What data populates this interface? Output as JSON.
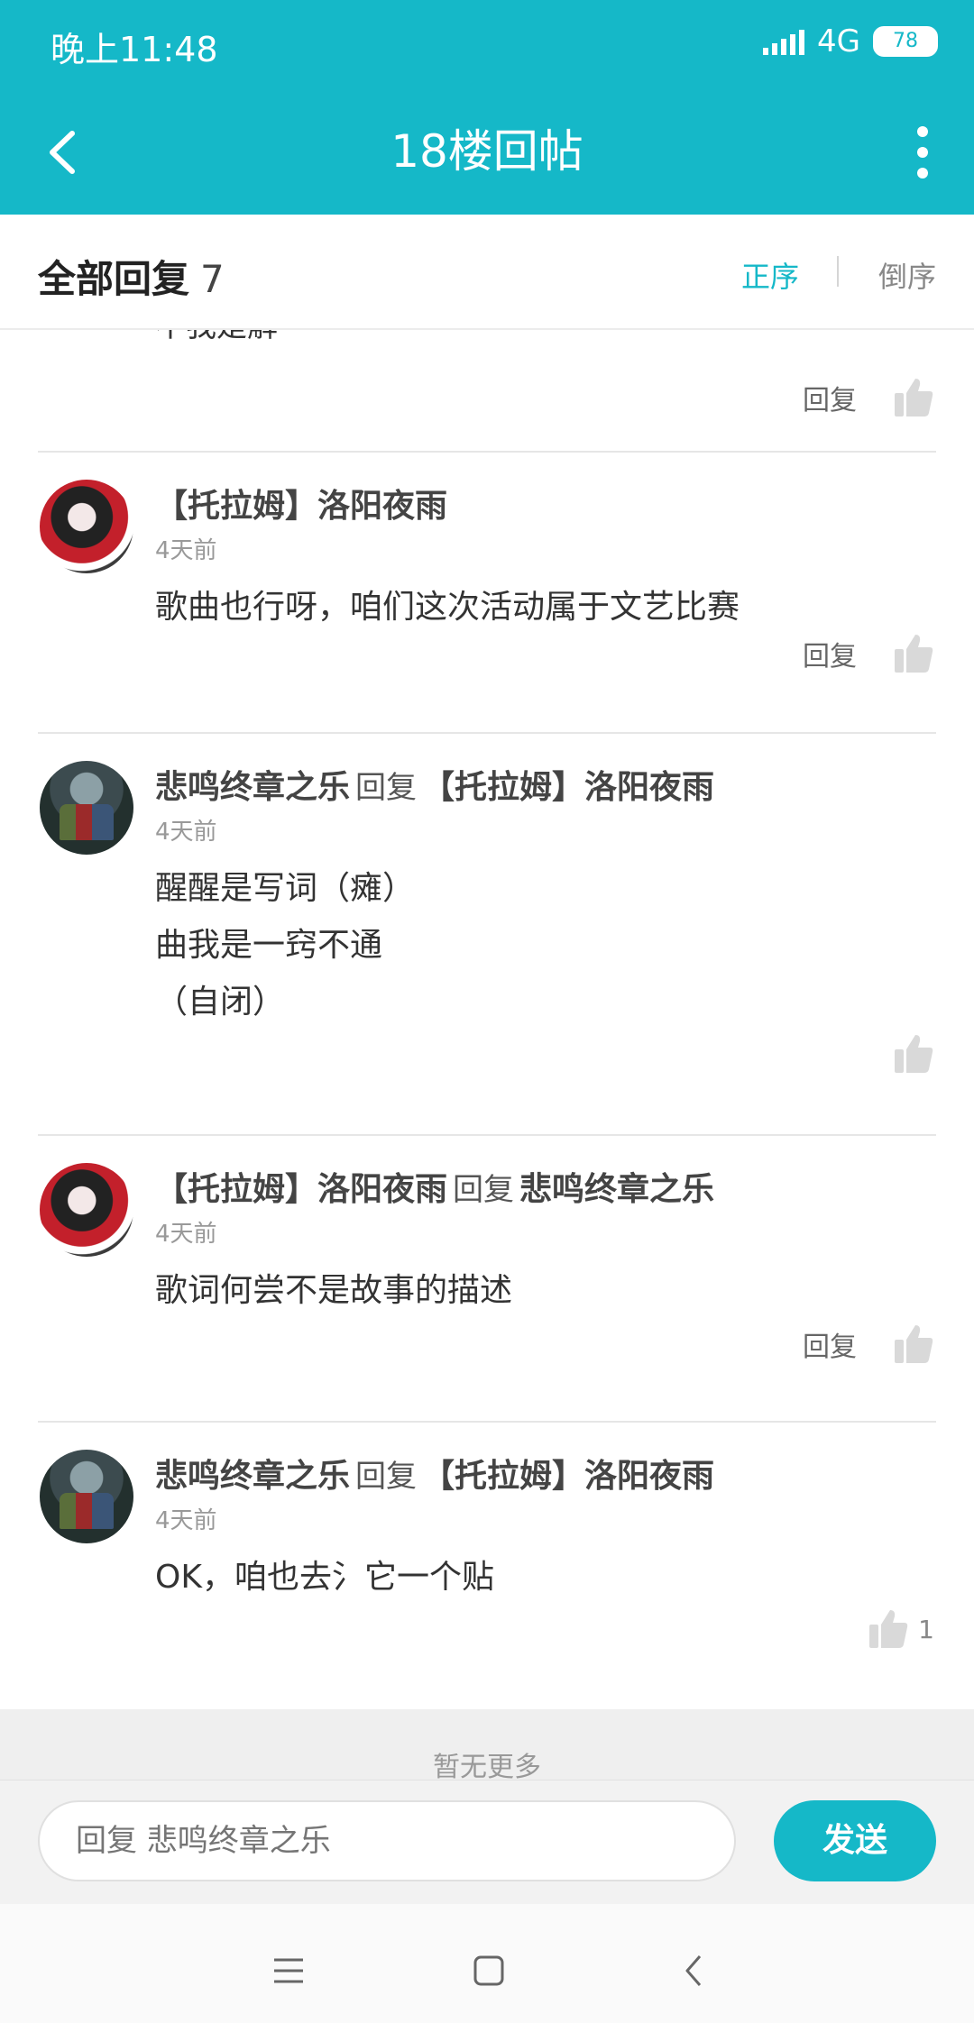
{
  "status_bar": {
    "time": "晚上11:48",
    "network": "4G",
    "battery": "78"
  },
  "app_bar": {
    "title": "18楼回帖",
    "back_icon": "back-arrow-icon",
    "more_icon": "more-vertical-icon"
  },
  "sort_bar": {
    "title": "全部回复",
    "count": "7",
    "asc_label": "正序",
    "desc_label": "倒序"
  },
  "partial_item": {
    "text": "不我是解",
    "reply_label": "回复"
  },
  "comments": [
    {
      "author": "【托拉姆】洛阳夜雨",
      "reply_word": "",
      "reply_to": "",
      "time": "4天前",
      "lines": [
        "歌曲也行呀，咱们这次活动属于文艺比赛"
      ],
      "reply_label": "回复",
      "likes": ""
    },
    {
      "author": "悲鸣终章之乐",
      "reply_word": "回复",
      "reply_to": "【托拉姆】洛阳夜雨",
      "time": "4天前",
      "lines": [
        "醒醒是写词（瘫）",
        "曲我是一窍不通",
        "（自闭）"
      ],
      "reply_label": "",
      "likes": ""
    },
    {
      "author": "【托拉姆】洛阳夜雨",
      "reply_word": "回复",
      "reply_to": "悲鸣终章之乐",
      "time": "4天前",
      "lines": [
        "歌词何尝不是故事的描述"
      ],
      "reply_label": "回复",
      "likes": ""
    },
    {
      "author": "悲鸣终章之乐",
      "reply_word": "回复",
      "reply_to": "【托拉姆】洛阳夜雨",
      "time": "4天前",
      "lines": [
        "OK，咱也去氵它一个贴"
      ],
      "reply_label": "",
      "likes": "1"
    }
  ],
  "footer": {
    "no_more": "暂无更多"
  },
  "composer": {
    "placeholder": "回复 悲鸣终章之乐",
    "send_label": "发送"
  },
  "colors": {
    "accent": "#15b8c8",
    "like_icon": "#d9d9d9"
  }
}
